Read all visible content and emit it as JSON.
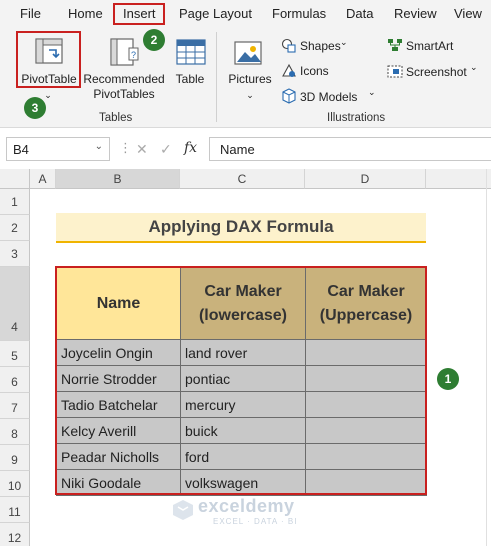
{
  "menu": {
    "tabs": [
      "File",
      "Home",
      "Insert",
      "Page Layout",
      "Formulas",
      "Data",
      "Review",
      "View"
    ]
  },
  "ribbon": {
    "pivot_table": "PivotTable",
    "recommended_1": "Recommended",
    "recommended_2": "PivotTables",
    "table": "Table",
    "group_tables": "Tables",
    "pictures": "Pictures",
    "shapes": "Shapes",
    "icons": "Icons",
    "models_3d": "3D Models",
    "smartart": "SmartArt",
    "screenshot": "Screenshot",
    "group_illustrations": "Illustrations"
  },
  "badges": {
    "b1": "1",
    "b2": "2",
    "b3": "3"
  },
  "formula_bar": {
    "name_box": "B4",
    "cancel": "✕",
    "enter": "✓",
    "fx": "fx",
    "value": "Name"
  },
  "columns": [
    "A",
    "B",
    "C",
    "D"
  ],
  "rows": [
    "1",
    "2",
    "3",
    "4",
    "5",
    "6",
    "7",
    "8",
    "9",
    "10",
    "11",
    "12"
  ],
  "sheet": {
    "title": "Applying DAX Formula",
    "headers": {
      "name": "Name",
      "maker_lower_1": "Car Maker",
      "maker_lower_2": "(lowercase)",
      "maker_upper_1": "Car Maker",
      "maker_upper_2": "(Uppercase)"
    },
    "records": [
      {
        "name": "Joycelin Ongin",
        "maker": "land rover",
        "upper": ""
      },
      {
        "name": "Norrie Strodder",
        "maker": "pontiac",
        "upper": ""
      },
      {
        "name": "Tadio Batchelar",
        "maker": "mercury",
        "upper": ""
      },
      {
        "name": "Kelcy Averill",
        "maker": "buick",
        "upper": ""
      },
      {
        "name": "Peadar Nicholls",
        "maker": "ford",
        "upper": ""
      },
      {
        "name": "Niki Goodale",
        "maker": "volkswagen",
        "upper": ""
      }
    ]
  },
  "watermark": {
    "brand": "exceldemy",
    "tagline": "EXCEL · DATA · BI"
  },
  "colors": {
    "accent_red": "#c9201f",
    "badge_green": "#2e7d32",
    "header_yellow": "#ffe699",
    "header_tan": "#c9b27c",
    "cell_gray": "#c8c8c8",
    "title_fill": "#fdf2cc"
  }
}
